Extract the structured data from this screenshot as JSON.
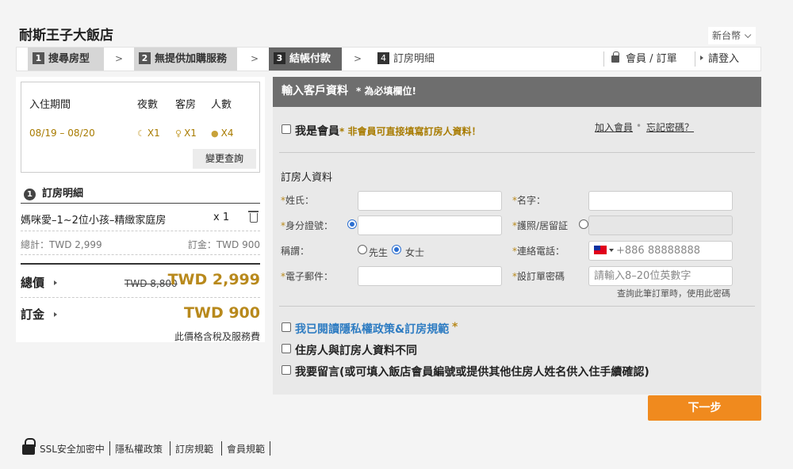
{
  "hotel": {
    "name": "耐斯王子大飯店"
  },
  "currency": {
    "label": "新台幣"
  },
  "steps": [
    {
      "num": "1",
      "label": "搜尋房型"
    },
    {
      "num": "2",
      "label": "無提供加購服務"
    },
    {
      "num": "3",
      "label": "結帳付款"
    },
    {
      "num": "4",
      "label": "訂房明細"
    }
  ],
  "step_separator": ">",
  "header_links": {
    "member": "會員 / 訂單",
    "login": "請登入"
  },
  "search": {
    "headers": {
      "period": "入住期間",
      "nights": "夜數",
      "rooms": "客房",
      "guests": "人數"
    },
    "period": "08/19 – 08/20",
    "nights": "X1",
    "rooms": "X1",
    "guests": "X4",
    "icons": {
      "nights": "moon-icon",
      "rooms": "key-icon",
      "guests": "person-icon"
    },
    "change_button": "變更查詢"
  },
  "booking": {
    "section_num": "1",
    "section_title": "訂房明細",
    "room_name": "媽咪愛–1~2位小孩–精緻家庭房",
    "room_qty": "x 1",
    "subtotal": "總計：TWD 2,999",
    "deposit_small": "訂金：TWD 900",
    "total_label": "總價",
    "old_price": "TWD 8,800",
    "total_price": "TWD 2,999",
    "deposit_label": "訂金",
    "deposit_price": "TWD 900",
    "tax_note": "此價格含稅及服務費"
  },
  "form": {
    "header": "輸入客戶資料",
    "required_note": "* 為必填欄位!",
    "member_label": "我是會員",
    "member_note": "* 非會員可直接填寫訂房人資料！",
    "join_link": "加入會員",
    "dot": "•",
    "forgot_link": "忘記密碼？",
    "section_title": "訂房人資料",
    "star": "*",
    "fields": {
      "last_name": "姓氏：",
      "first_name": "名字：",
      "id_number": "身分證號：",
      "passport": "護照/居留証",
      "title": "稱謂：",
      "phone": "連絡電話：",
      "email": "電子郵件：",
      "password": "設訂單密碼"
    },
    "title_options": {
      "mr": "先生",
      "ms": "女士"
    },
    "phone_placeholder": "+886 88888888",
    "password_placeholder": "請輸入8–20位英數字",
    "password_hint": "查詢此筆訂單時，使用此密碼",
    "policy_label": "我已閱讀隱私權政策&訂房規範",
    "different_guest_label": "住房人與訂房人資料不同",
    "message_label": "我要留言(或可填入飯店會員編號或提供其他住房人姓名供入住手續確認)"
  },
  "next_button": "下一步",
  "footer": {
    "ssl": "SSL安全加密中",
    "privacy": "隱私權政策",
    "rules": "訂房規範",
    "member_rules": "會員規範"
  },
  "colors": {
    "accent_gold": "#b8891c",
    "button_orange": "#f08a1e",
    "link_blue": "#2e7cc2"
  }
}
